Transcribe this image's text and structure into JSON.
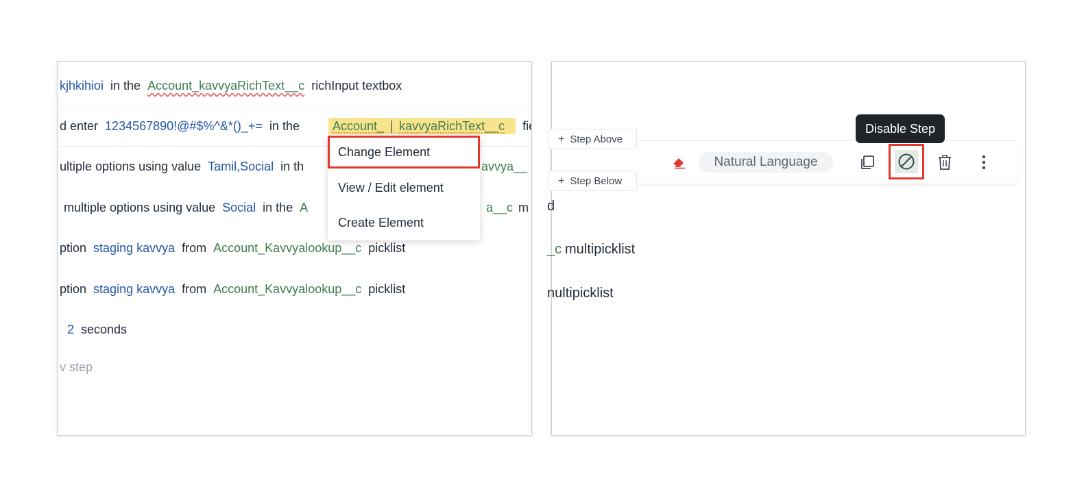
{
  "left_panel": {
    "lines": [
      [
        {
          "t": "kjhkihioi",
          "c": "tok"
        },
        {
          "t": "in the",
          "c": "plain"
        },
        {
          "t": "Account_kavvyaRichText__c",
          "c": "el squig"
        },
        {
          "t": "richInput textbox",
          "c": "plain"
        }
      ],
      [
        {
          "t": "d enter",
          "c": "plain"
        },
        {
          "t": "1234567890!@#$%^&*()_+=",
          "c": "tok"
        },
        {
          "t": "in the",
          "c": "plain"
        }
      ],
      [
        {
          "t": "ultiple options using value",
          "c": "plain"
        },
        {
          "t": "Tamil,Social",
          "c": "tok"
        },
        {
          "t": "in th",
          "c": "plain"
        }
      ],
      [
        {
          "t": "multiple options using value",
          "c": "plain"
        },
        {
          "t": "Social",
          "c": "tok"
        },
        {
          "t": "in the",
          "c": "plain"
        },
        {
          "t": "A",
          "c": "el"
        }
      ],
      [
        {
          "t": "ption",
          "c": "plain"
        },
        {
          "t": "staging kavvya",
          "c": "tok"
        },
        {
          "t": "from",
          "c": "plain"
        },
        {
          "t": "Account_Kavvyalookup__c",
          "c": "el"
        },
        {
          "t": "picklist",
          "c": "plain"
        }
      ],
      [
        {
          "t": "ption",
          "c": "plain"
        },
        {
          "t": "staging kavvya",
          "c": "tok"
        },
        {
          "t": "from",
          "c": "plain"
        },
        {
          "t": "Account_Kavvyalookup__c",
          "c": "el"
        },
        {
          "t": "picklist",
          "c": "plain"
        }
      ],
      [
        {
          "t": "2",
          "c": "tok"
        },
        {
          "t": "seconds",
          "c": "plain"
        }
      ],
      [
        {
          "t": "v step",
          "c": "new-step"
        }
      ]
    ],
    "highlight_element_a": "Account_",
    "highlight_element_b": "kavvyaRichText__c",
    "line2_tail": "field",
    "line3_tail": "avvya__",
    "line4_tail_a": "a__c",
    "line4_tail_b": "m"
  },
  "dropdown": {
    "items": [
      "Change Element",
      "View / Edit element",
      "Create Element"
    ]
  },
  "right_panel": {
    "step_above": "Step Above",
    "step_below": "Step Below",
    "mode_label": "Natural Language",
    "tooltip": "Disable Step",
    "fragments": [
      "d",
      "_c",
      "multipicklist",
      "nultipicklist"
    ]
  },
  "icons": {
    "eraser": "eraser-icon",
    "copy": "copy-icon",
    "disable": "disable-icon",
    "delete": "trash-icon",
    "more": "more-vertical-icon"
  },
  "colors": {
    "highlight_border": "#e0382c",
    "token_blue": "#2456a6",
    "element_green": "#3e7d4f",
    "highlight_yellow": "#f8e48c"
  }
}
